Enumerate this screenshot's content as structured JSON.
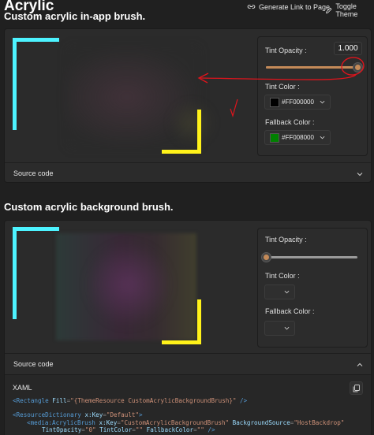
{
  "page": {
    "title": "Acrylic"
  },
  "header": {
    "generate_link": {
      "label": "Generate Link to Page",
      "icon": "link-icon"
    },
    "toggle_theme": {
      "label": "Toggle Theme",
      "icon": "pen-icon"
    }
  },
  "sections": [
    {
      "title": "Custom acrylic in-app brush.",
      "options": {
        "tint_opacity_label": "Tint Opacity :",
        "tint_opacity_value": "1.000",
        "tint_opacity_fraction": 1.0,
        "tint_color_label": "Tint Color :",
        "tint_color_value": "#FF000000",
        "tint_color_swatch": "#000000",
        "fallback_color_label": "Fallback Color :",
        "fallback_color_value": "#FF008000",
        "fallback_color_swatch": "#008000"
      },
      "source_code_label": "Source code"
    },
    {
      "title": "Custom acrylic background brush.",
      "options": {
        "tint_opacity_label": "Tint Opacity :",
        "tint_opacity_fraction": 0.0,
        "tint_color_label": "Tint Color :",
        "fallback_color_label": "Fallback Color :"
      },
      "source_code_label": "Source code",
      "code_language": "XAML",
      "code": {
        "line1": {
          "open": "<",
          "tag": "Rectangle",
          "attr": " Fill",
          "eq": "=",
          "value": "\"{ThemeResource CustomAcrylicBackgroundBrush}\"",
          "close": " />"
        },
        "line2": {
          "open": "<",
          "tag": "ResourceDictionary",
          "attr": " x:Key",
          "eq": "=",
          "value": "\"Default\"",
          "close": ">"
        },
        "line3": {
          "open": "<",
          "tag": "media:AcrylicBrush",
          "attr1": " x:Key",
          "value1": "\"CustomAcrylicBackgroundBrush\"",
          "attr2": " BackgroundSource",
          "value2": "\"HostBackdrop\""
        },
        "line4": {
          "attr1": "TintOpacity",
          "value1": "\"0\"",
          "attr2": " TintColor",
          "value2": "\"\"",
          "attr3": " FallbackColor",
          "value3": "\"\"",
          "close": " />"
        }
      }
    }
  ],
  "colors": {
    "background": "#202020",
    "card": "#2b2b2b",
    "cyan_bracket": "#4df3ff",
    "yellow_bracket": "#fff21a",
    "annotation_red": "#e0141c",
    "accent": "#c48a58"
  }
}
